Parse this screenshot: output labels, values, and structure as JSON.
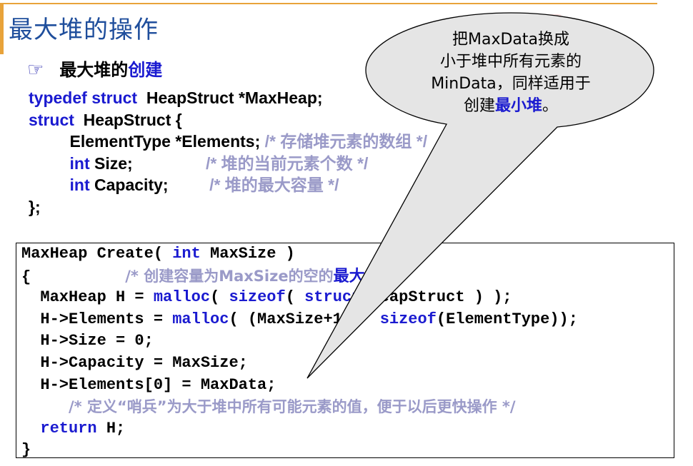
{
  "title": "最大堆的操作",
  "bullet": {
    "icon": "pointing-hand-icon",
    "text_black": "最大堆的",
    "text_blue": "创建"
  },
  "typedef_block": [
    [
      {
        "t": "typedef ",
        "c": "kw"
      },
      {
        "t": "struct ",
        "c": "kw"
      },
      {
        "t": " HeapStruct *MaxHeap;",
        "c": ""
      }
    ],
    [
      {
        "t": "struct ",
        "c": "kw"
      },
      {
        "t": " HeapStruct {",
        "c": ""
      }
    ],
    [
      {
        "t": "         ElementType *Elements; ",
        "c": ""
      },
      {
        "t": "/* 存储堆元素的数组 */",
        "c": "cm"
      }
    ],
    [
      {
        "t": "         int",
        "c": "kw"
      },
      {
        "t": " Size;                ",
        "c": ""
      },
      {
        "t": "/* 堆的当前元素个数 */",
        "c": "cm"
      }
    ],
    [
      {
        "t": "         int",
        "c": "kw"
      },
      {
        "t": " Capacity;         ",
        "c": ""
      },
      {
        "t": "/* 堆的最大容量 */",
        "c": "cm"
      }
    ],
    [
      {
        "t": "};",
        "c": ""
      }
    ]
  ],
  "create_block": [
    [
      {
        "t": "MaxHeap Create( ",
        "c": ""
      },
      {
        "t": "int",
        "c": "kw"
      },
      {
        "t": " MaxSize )",
        "c": ""
      }
    ],
    [
      {
        "t": "{          ",
        "c": ""
      },
      {
        "t": "/* 创建容量为MaxSize的空的",
        "c": "cm"
      },
      {
        "t": "最大堆",
        "c": "blueb"
      },
      {
        "t": " */",
        "c": "cm"
      }
    ],
    [
      {
        "t": "  MaxHeap H = ",
        "c": ""
      },
      {
        "t": "malloc",
        "c": "kw"
      },
      {
        "t": "( ",
        "c": ""
      },
      {
        "t": "sizeof",
        "c": "kw"
      },
      {
        "t": "( ",
        "c": ""
      },
      {
        "t": "struct",
        "c": "kw"
      },
      {
        "t": " HeapStruct ) );",
        "c": ""
      }
    ],
    [
      {
        "t": "  H->Elements = ",
        "c": ""
      },
      {
        "t": "malloc",
        "c": "kw"
      },
      {
        "t": "( (MaxSize+1) * ",
        "c": ""
      },
      {
        "t": "sizeof",
        "c": "kw"
      },
      {
        "t": "(ElementType));",
        "c": ""
      }
    ],
    [
      {
        "t": "  H->Size = 0;",
        "c": ""
      }
    ],
    [
      {
        "t": "  H->Capacity = MaxSize;",
        "c": ""
      }
    ],
    [
      {
        "t": "  H->Elements[0] = MaxData;",
        "c": ""
      }
    ],
    [
      {
        "t": "     ",
        "c": ""
      },
      {
        "t": "/* 定义“哨兵”为大于堆中所有可能元素的值，便于以后更快操作 */",
        "c": "cm"
      }
    ],
    [
      {
        "t": "  ",
        "c": ""
      },
      {
        "t": "return",
        "c": "kw"
      },
      {
        "t": " H;",
        "c": ""
      }
    ],
    [
      {
        "t": "}",
        "c": ""
      }
    ]
  ],
  "callout": {
    "line1": "把MaxData换成",
    "line2": "小于堆中所有元素的",
    "line3": "MinData，同样适用于",
    "line4_prefix": "创建",
    "line4_blue": "最小堆",
    "line4_suffix": "。"
  },
  "colors": {
    "title": "#1f4e9c",
    "keyword": "#1a1ad0",
    "comment": "#9a9ac8",
    "accent_line": "#e8a33a"
  }
}
